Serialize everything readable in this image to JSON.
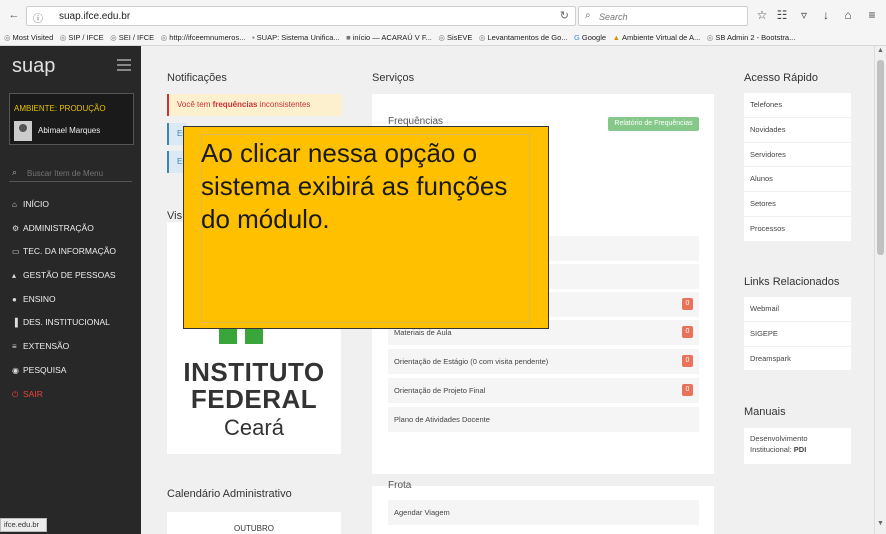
{
  "browser": {
    "url": "suap.ifce.edu.br",
    "search_placeholder": "Search",
    "bookmarks": [
      {
        "icon": "firefox-icon",
        "label": "Most Visited"
      },
      {
        "icon": "globe-icon",
        "label": "SIP / IFCE"
      },
      {
        "icon": "globe-icon",
        "label": "SEI / IFCE"
      },
      {
        "icon": "globe-icon",
        "label": "http://ifceemnumeros..."
      },
      {
        "icon": "suap-icon",
        "label": "SUAP: Sistema Unifica..."
      },
      {
        "icon": "flag-icon",
        "label": "início — ACARAÚ V F..."
      },
      {
        "icon": "globe-icon",
        "label": "SisEVE"
      },
      {
        "icon": "globe-icon",
        "label": "Levantamentos de Go..."
      },
      {
        "icon": "google-icon",
        "label": "Google"
      },
      {
        "icon": "ava-icon",
        "label": "Ambiente Virtual de A..."
      },
      {
        "icon": "globe-icon",
        "label": "SB Admin 2 - Bootstra..."
      }
    ],
    "status_text": "ifce.edu.br"
  },
  "sidebar": {
    "logo": "suap",
    "environment": "AMBIENTE: PRODUÇÃO",
    "user_name": "Abimael Marques",
    "search_placeholder": "Buscar Item de Menu",
    "items": [
      {
        "icon": "home-icon",
        "label": "INÍCIO"
      },
      {
        "icon": "gears-icon",
        "label": "ADMINISTRAÇÃO"
      },
      {
        "icon": "monitor-icon",
        "label": "TEC. DA INFORMAÇÃO"
      },
      {
        "icon": "user-icon",
        "label": "GESTÃO DE PESSOAS"
      },
      {
        "icon": "ensino-icon",
        "label": "ENSINO"
      },
      {
        "icon": "bar-chart-icon",
        "label": "DES. INSTITUCIONAL"
      },
      {
        "icon": "extensao-icon",
        "label": "EXTENSÃO"
      },
      {
        "icon": "pesquisa-icon",
        "label": "PESQUISA"
      },
      {
        "icon": "power-icon",
        "label": "SAIR"
      }
    ]
  },
  "main": {
    "notifications_title": "Notificações",
    "notification_prefix": "Você tem ",
    "notification_bold": "frequências",
    "notification_suffix": " inconsistentes",
    "notif_info_1": "Es",
    "notif_info_2": "Es",
    "visao_partial": "Vis",
    "institute_line1": "INSTITUTO",
    "institute_line2": "FEDERAL",
    "institute_line3": "Ceará",
    "calendar_title": "Calendário Administrativo",
    "calendar_partial": "OUTUBRO",
    "services_title": "Serviços",
    "frequencias_label": "Frequências",
    "relatorio_button": "Relatório de Frequências",
    "services_items": [
      {
        "label": "Materiais de Aula",
        "badge": "0"
      },
      {
        "label": "Orientação de Estágio (0 com visita pendente)",
        "badge": "0"
      },
      {
        "label": "Orientação de Projeto Final",
        "badge": "0"
      },
      {
        "label": "Plano de Atividades Docente",
        "badge": ""
      }
    ],
    "frota_title": "Frota",
    "agendar_label": "Agendar Viagem",
    "acesso_rapido_title": "Acesso Rápido",
    "acesso_rapido": [
      "Telefones",
      "Novidades",
      "Servidores",
      "Alunos",
      "Setores",
      "Processos"
    ],
    "links_title": "Links Relacionados",
    "links": [
      "Webmail",
      "SIGEPE",
      "Dreamspark"
    ],
    "manuais_title": "Manuais",
    "manual_text": "Desenvolvimento Institucional: ",
    "manual_bold": "PDI"
  },
  "tooltip": {
    "text": "Ao clicar nessa opção o sistema exibirá as funções do módulo."
  },
  "colors": {
    "tooltip_bg": "#ffc000",
    "sidebar_bg": "#282828",
    "environment_text": "#e6c300",
    "sair": "#e8453c",
    "badge": "#e8735a",
    "relatorio_button": "#85c88a"
  }
}
